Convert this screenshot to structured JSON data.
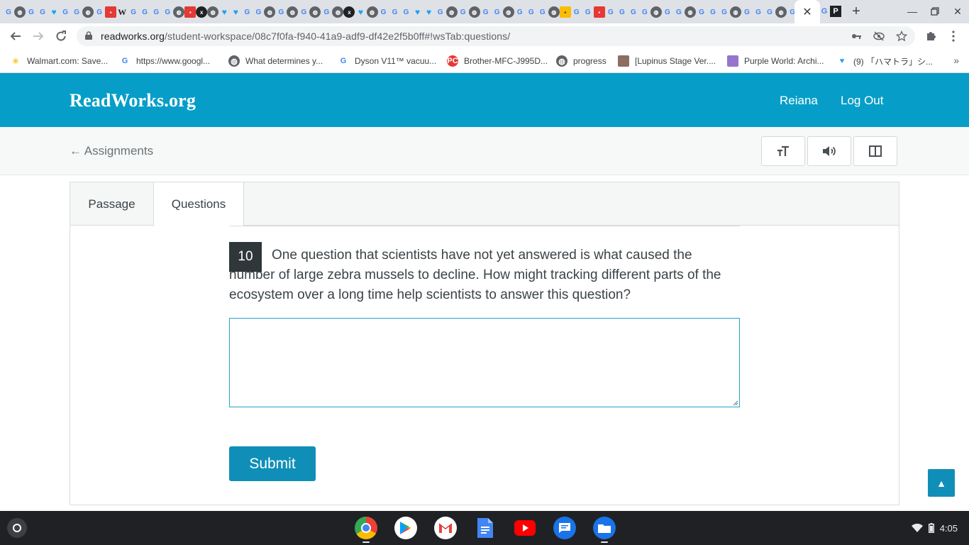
{
  "browser": {
    "tab_close_glyph": "✕",
    "new_tab_glyph": "+",
    "url_host": "readworks.org",
    "url_path": "/student-workspace/08c7f0fa-f940-41a9-adf9-df42e2f5b0ff#!wsTab:questions/",
    "bookmarks": [
      {
        "label": "Walmart.com: Save...",
        "icon": "walmart-icon"
      },
      {
        "label": "https://www.googl...",
        "icon": "google-icon"
      },
      {
        "label": "What determines y...",
        "icon": "globe-icon"
      },
      {
        "label": "Dyson V11™ vacuu...",
        "icon": "google-icon"
      },
      {
        "label": "Brother-MFC-J995D...",
        "icon": "pc-icon"
      },
      {
        "label": "progress",
        "icon": "globe-icon"
      },
      {
        "label": "[Lupinus Stage Ver....",
        "icon": "image-icon"
      },
      {
        "label": "Purple World: Archi...",
        "icon": "image-icon"
      },
      {
        "label": "(9) 「ハマトラ」シ...",
        "icon": "twitter-icon"
      }
    ],
    "bookmarks_overflow": "»"
  },
  "site": {
    "logo": "ReadWorks.org",
    "user_name": "Reiana",
    "logout_label": "Log Out",
    "back_label": "← Assignments"
  },
  "workspace": {
    "tabs": [
      {
        "label": "Passage",
        "active": false
      },
      {
        "label": "Questions",
        "active": true
      }
    ],
    "question_number": "10",
    "question_text": "One question that scientists have not yet answered is what caused the number of large zebra mussels to decline. How might tracking different parts of the ecosystem over a long time help scientists to answer this question?",
    "answer_value": "",
    "submit_label": "Submit",
    "back_to_top_glyph": "▲"
  },
  "shelf": {
    "time": "4:05",
    "apps": [
      "chrome",
      "play-store",
      "gmail",
      "docs",
      "youtube",
      "messages",
      "files"
    ]
  },
  "colors": {
    "brand": "#069ec8",
    "button": "#0f8fb8",
    "question_badge": "#2f373b"
  }
}
